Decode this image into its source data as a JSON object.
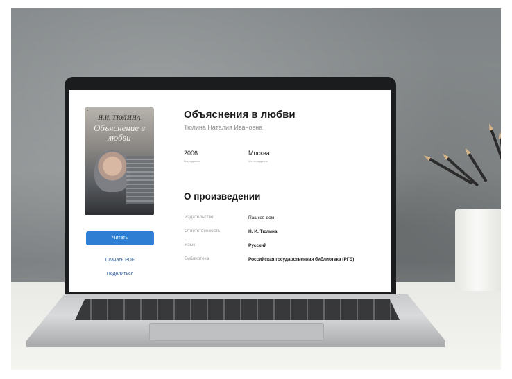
{
  "book": {
    "cover": {
      "author_text": "Н.И. ТЮЛИНА",
      "title_text": "Объяснение в любви"
    },
    "title": "Объяснения в любви",
    "author": "Тюлина Наталия Ивановна",
    "year": {
      "value": "2006",
      "label": "Год издания"
    },
    "place": {
      "value": "Москва",
      "label": "Место издания"
    }
  },
  "actions": {
    "read_label": "Читать",
    "pdf_label": "Скачать PDF",
    "share_label": "Поделиться"
  },
  "about": {
    "heading": "О произведении",
    "rows": [
      {
        "label": "Издательство",
        "value": "Пашков дом"
      },
      {
        "label": "Ответственность",
        "value": "Н. И. Тюлина"
      },
      {
        "label": "Язык",
        "value": "Русский"
      },
      {
        "label": "Библиотека",
        "value": "Российская государственная библиотека (РГБ)"
      }
    ]
  },
  "colors": {
    "accent": "#2e7ed3",
    "link": "#2f5f9a"
  }
}
